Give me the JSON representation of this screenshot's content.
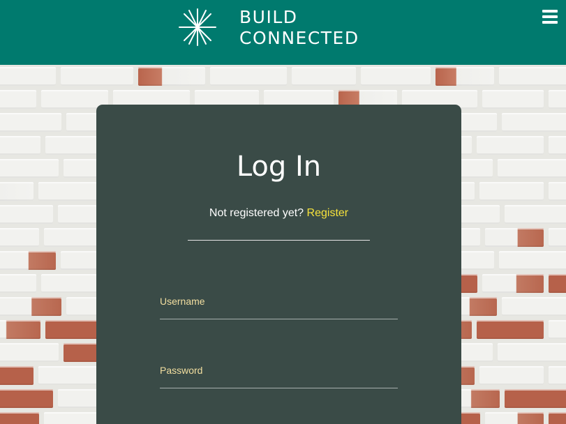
{
  "header": {
    "brand_line1": "BUILD",
    "brand_line2": "CONNECTED",
    "logo_icon": "asterisk-star-logo-icon",
    "menu_icon": "hamburger-menu-icon",
    "background_color": "#007a6e"
  },
  "login": {
    "title": "Log In",
    "prompt": "Not registered yet?",
    "register_label": "Register",
    "username_label": "Username",
    "username_value": "",
    "password_label": "Password",
    "password_value": "",
    "card_color": "#3a4b47",
    "link_color": "#f6e23c",
    "field_label_color": "#f3dfa0"
  }
}
